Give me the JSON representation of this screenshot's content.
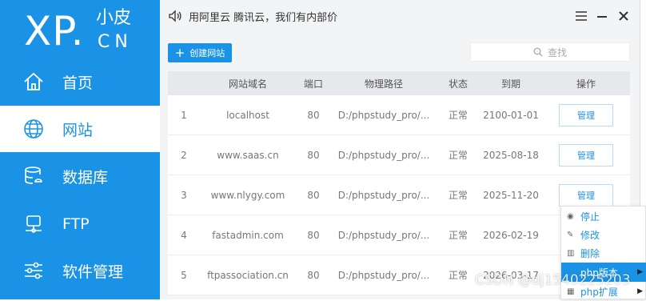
{
  "logo": {
    "brand": "XP.",
    "cn_top": "小皮",
    "cn_bottom": "CN"
  },
  "sidebar": {
    "items": [
      {
        "label": "首页",
        "icon": "home-icon",
        "active": false
      },
      {
        "label": "网站",
        "icon": "globe-icon",
        "active": true
      },
      {
        "label": "数据库",
        "icon": "database-icon",
        "active": false
      },
      {
        "label": "FTP",
        "icon": "monitor-icon",
        "active": false
      },
      {
        "label": "软件管理",
        "icon": "sliders-icon",
        "active": false
      }
    ]
  },
  "titlebar": {
    "announcement": "用阿里云 腾讯云，我们有内部价"
  },
  "toolbar": {
    "create_label": "创建网站",
    "search_placeholder": "查找"
  },
  "table": {
    "headers": [
      "",
      "网站域名",
      "端口",
      "物理路径",
      "状态",
      "到期",
      "操作"
    ],
    "rows": [
      {
        "idx": "1",
        "domain": "localhost",
        "port": "80",
        "path": "D:/phpstudy_pro/...",
        "status": "正常",
        "expires": "2100-01-01",
        "action": "管理"
      },
      {
        "idx": "2",
        "domain": "www.saas.cn",
        "port": "80",
        "path": "D:/phpstudy_pro/...",
        "status": "正常",
        "expires": "2025-08-18",
        "action": "管理"
      },
      {
        "idx": "3",
        "domain": "www.nlygy.com",
        "port": "80",
        "path": "D:/phpstudy_pro/...",
        "status": "正常",
        "expires": "2025-11-20",
        "action": "管理"
      },
      {
        "idx": "4",
        "domain": "fastadmin.com",
        "port": "80",
        "path": "D:/phpstudy_pro/...",
        "status": "正常",
        "expires": "2026-02-19",
        "action": ""
      },
      {
        "idx": "5",
        "domain": "ftpassociation.cn",
        "port": "80",
        "path": "D:/phpstudy_pro/...",
        "status": "正常",
        "expires": "2026-03-17",
        "action": ""
      }
    ]
  },
  "context_menu": {
    "items": [
      {
        "label": "停止",
        "icon": "stop-icon"
      },
      {
        "label": "修改",
        "icon": "edit-icon"
      },
      {
        "label": "删除",
        "icon": "trash-icon"
      },
      {
        "label": "php版本",
        "icon": "php-icon",
        "highlighted": true
      },
      {
        "label": "php扩展",
        "icon": "php-icon",
        "highlighted": false
      }
    ]
  },
  "watermark": "CSDN @dj1540225203",
  "colors": {
    "accent": "#1a93e6",
    "background": "#f3f4f6"
  }
}
